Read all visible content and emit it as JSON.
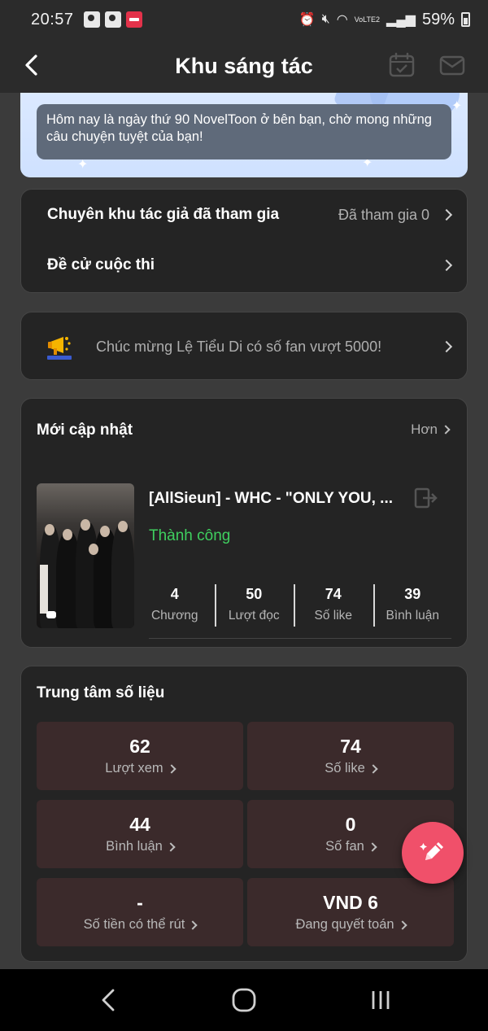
{
  "status_bar": {
    "time": "20:57",
    "network": "VoLTE2",
    "battery": "59%"
  },
  "header": {
    "title": "Khu sáng tác",
    "icons": [
      "back-arrow-icon",
      "calendar-icon",
      "mail-icon"
    ]
  },
  "banner": {
    "message": "Hôm nay là ngày thứ 90 NovelToon ở bên bạn, chờ mong những câu chuyện tuyệt của bạn!"
  },
  "menu": {
    "items": [
      {
        "label": "Chuyên khu tác giả đã tham gia",
        "value": "Đã tham gia 0"
      },
      {
        "label": "Đề cử cuộc thi",
        "value": ""
      }
    ]
  },
  "announcement": {
    "icon": "megaphone-icon",
    "text": "Chúc mừng Lệ Tiểu Di có số fan vượt 5000!"
  },
  "recent": {
    "title": "Mới cập nhật",
    "more_label": "Hơn",
    "book": {
      "title": "[AllSieun] - WHC - \"ONLY YOU, ...",
      "status": "Thành công",
      "status_color": "#3fcf5f",
      "stats": [
        {
          "value": "4",
          "label": "Chương"
        },
        {
          "value": "50",
          "label": "Lượt đọc"
        },
        {
          "value": "74",
          "label": "Số like"
        },
        {
          "value": "39",
          "label": "Bình luận"
        }
      ]
    }
  },
  "data_center": {
    "title": "Trung tâm số liệu",
    "tiles": [
      {
        "value": "62",
        "label": "Lượt xem"
      },
      {
        "value": "74",
        "label": "Số like"
      },
      {
        "value": "44",
        "label": "Bình luận"
      },
      {
        "value": "0",
        "label": "Số fan"
      },
      {
        "value": "-",
        "label": "Số tiền có thể rút"
      },
      {
        "value": "VND 6",
        "label": "Đang quyết toán"
      }
    ]
  },
  "fab": {
    "icon": "pencil-icon",
    "color": "#f0506a"
  },
  "nav_bar": {
    "icons": [
      "nav-back-icon",
      "nav-home-icon",
      "nav-recents-icon"
    ]
  }
}
